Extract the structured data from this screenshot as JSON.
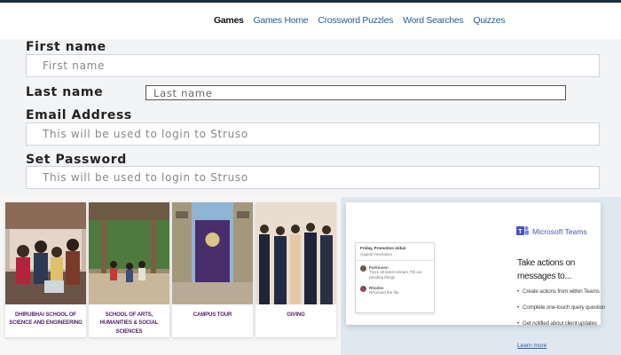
{
  "nav": {
    "items": [
      {
        "label": "Games",
        "active": true
      },
      {
        "label": "Games Home",
        "active": false
      },
      {
        "label": "Crossword Puzzles",
        "active": false
      },
      {
        "label": "Word Searches",
        "active": false
      },
      {
        "label": "Quizzes",
        "active": false
      }
    ]
  },
  "form": {
    "first_name": {
      "label": "First name",
      "placeholder": "First name"
    },
    "last_name": {
      "label": "Last name",
      "placeholder": "Last name"
    },
    "email": {
      "label": "Email Address",
      "placeholder": "This will be used to login to Struso"
    },
    "password": {
      "label": "Set Password",
      "placeholder": "This will be used to login to Struso"
    }
  },
  "cards": [
    {
      "caption": "Dhirubhai School of Science and Engineering"
    },
    {
      "caption": "School of Arts, Humanities & Social Sciences"
    },
    {
      "caption": "Campus Tour"
    },
    {
      "caption": "Giving"
    }
  ],
  "promo": {
    "brand": "Microsoft Teams",
    "title": "Take actions on messages to...",
    "bullets": [
      "Create actions from within Teams",
      "Complete one-touch query question",
      "Get notified about client updates"
    ],
    "link": "Learn more",
    "mock_header": "Friday, Promotion initial",
    "mock_sub": "Capital Innovation",
    "mock_msg1_name": "Parkinson",
    "mock_msg1_text": "Track all latest stream, Fill our pending things",
    "mock_msg2_name": "Rhodes",
    "mock_msg2_text": "Received the file",
    "accent_color": "#4b53bc"
  }
}
